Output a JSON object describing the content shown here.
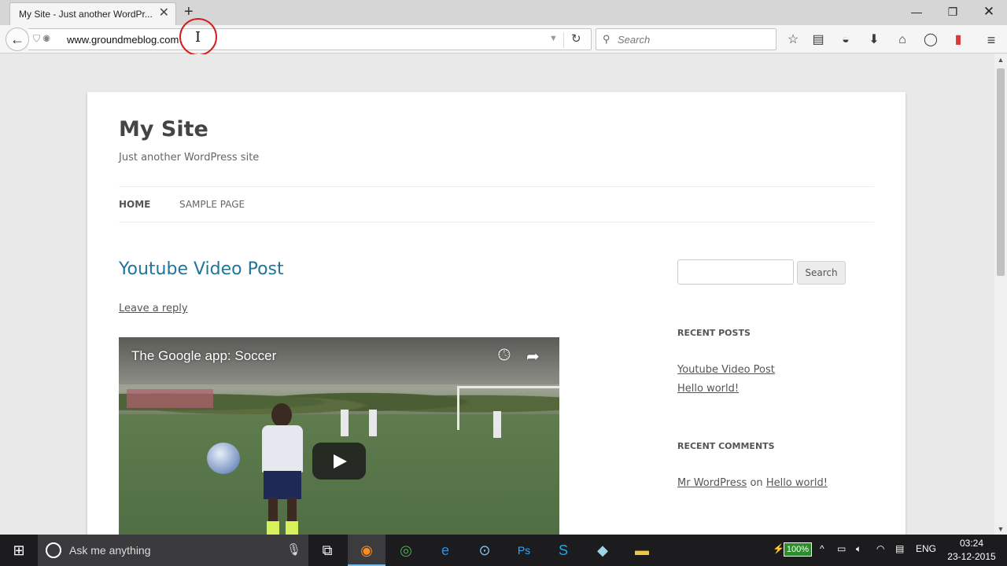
{
  "browser": {
    "tab_title": "My Site - Just another WordPr...",
    "url": "www.groundmeblog.com",
    "search_placeholder": "Search",
    "window_controls": [
      "minimize-icon",
      "restore-icon",
      "close-icon"
    ],
    "toolbar_icons": [
      "star-icon",
      "reading-list-icon",
      "pocket-icon",
      "download-icon",
      "home-icon",
      "chat-icon",
      "shield-addon-icon",
      "menu-icon"
    ]
  },
  "site": {
    "title": "My Site",
    "description": "Just another WordPress site",
    "nav": {
      "home": "HOME",
      "sample": "SAMPLE PAGE"
    },
    "post": {
      "title": "Youtube Video Post",
      "reply": "Leave a reply",
      "video_title": "The Google app: Soccer"
    },
    "sidebar": {
      "search_button": "Search",
      "recent_posts_title": "RECENT POSTS",
      "recent_posts": [
        "Youtube Video Post",
        "Hello world!"
      ],
      "recent_comments_title": "RECENT COMMENTS",
      "comment": {
        "author": "Mr WordPress",
        "on": "on",
        "post": "Hello world!"
      }
    },
    "link_color": "#21759b"
  },
  "taskbar": {
    "search_placeholder": "Ask me anything",
    "battery": "100%",
    "language": "ENG",
    "time": "03:24",
    "date": "23-12-2015"
  }
}
